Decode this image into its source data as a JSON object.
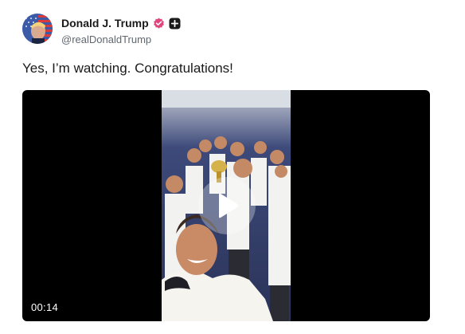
{
  "author": {
    "display_name": "Donald J. Trump",
    "handle": "@realDonaldTrump",
    "avatar_icon": "profile-photo-flag",
    "verified_badge_icon": "verified-check-badge",
    "verified_color": "#e0457b",
    "org_badge_icon": "plus-badge"
  },
  "post": {
    "text": "Yes, I’m watching. Congratulations!"
  },
  "video": {
    "duration": "00:14",
    "play_icon": "play-icon"
  }
}
